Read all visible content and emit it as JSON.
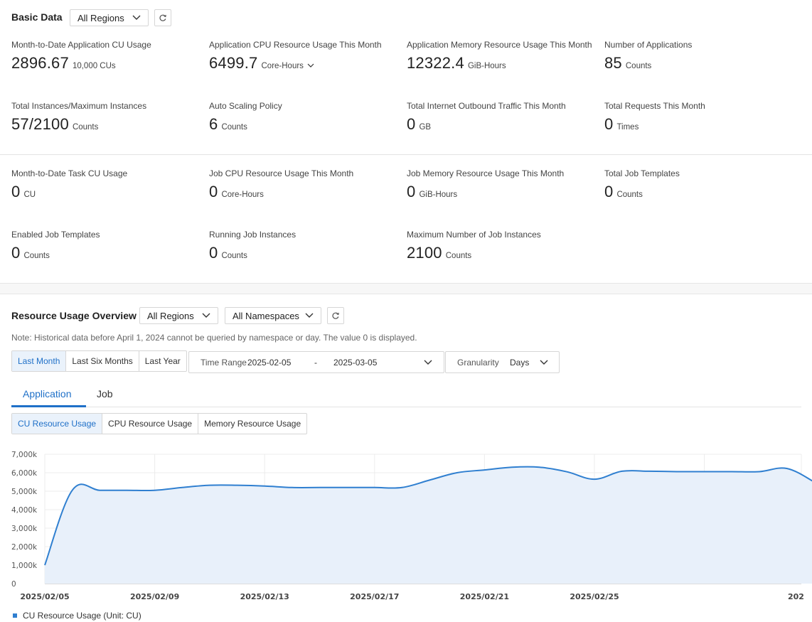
{
  "basic": {
    "title": "Basic Data",
    "region_select": "All Regions",
    "metrics_app": [
      {
        "label": "Month-to-Date Application CU Usage",
        "value": "2896.67",
        "unit": "10,000 CUs"
      },
      {
        "label": "Application CPU Resource Usage This Month",
        "value": "6499.7",
        "unit": "Core-Hours"
      },
      {
        "label": "Application Memory Resource Usage This Month",
        "value": "12322.4",
        "unit": "GiB-Hours"
      },
      {
        "label": "Number of Applications",
        "value": "85",
        "unit": "Counts"
      },
      {
        "label": "Total Instances/Maximum Instances",
        "value": "57/2100",
        "unit": "Counts"
      },
      {
        "label": "Auto Scaling Policy",
        "value": "6",
        "unit": "Counts"
      },
      {
        "label": "Total Internet Outbound Traffic This Month",
        "value": "0",
        "unit": "GB"
      },
      {
        "label": "Total Requests This Month",
        "value": "0",
        "unit": "Times"
      }
    ],
    "metrics_job": [
      {
        "label": "Month-to-Date Task CU Usage",
        "value": "0",
        "unit": "CU"
      },
      {
        "label": "Job CPU Resource Usage This Month",
        "value": "0",
        "unit": "Core-Hours"
      },
      {
        "label": "Job Memory Resource Usage This Month",
        "value": "0",
        "unit": "GiB-Hours"
      },
      {
        "label": "Total Job Templates",
        "value": "0",
        "unit": "Counts"
      },
      {
        "label": "Enabled Job Templates",
        "value": "0",
        "unit": "Counts"
      },
      {
        "label": "Running Job Instances",
        "value": "0",
        "unit": "Counts"
      },
      {
        "label": "Maximum Number of Job Instances",
        "value": "2100",
        "unit": "Counts"
      }
    ]
  },
  "overview": {
    "title": "Resource Usage Overview",
    "region_select": "All Regions",
    "namespace_select": "All Namespaces",
    "note": "Note: Historical data before April 1, 2024 cannot be queried by namespace or day. The value 0 is displayed.",
    "range_buttons": [
      "Last Month",
      "Last Six Months",
      "Last Year"
    ],
    "active_range": "Last Month",
    "time_range_label": "Time Range",
    "start_date": "2025-02-05",
    "date_separator": "-",
    "end_date": "2025-03-05",
    "granularity_label": "Granularity",
    "granularity_value": "Days",
    "tabs": [
      "Application",
      "Job"
    ],
    "active_tab": "Application",
    "metric_buttons": [
      "CU Resource Usage",
      "CPU Resource Usage",
      "Memory Resource Usage"
    ],
    "active_metric": "CU Resource Usage"
  },
  "colors": {
    "accent": "#1f70c8",
    "line": "#2f7fd0",
    "area": "#e8f0fa"
  },
  "chart_data": {
    "type": "area",
    "x": [
      "2025/02/05",
      "2025/02/06",
      "2025/02/07",
      "2025/02/08",
      "2025/02/09",
      "2025/02/10",
      "2025/02/11",
      "2025/02/12",
      "2025/02/13",
      "2025/02/14",
      "2025/02/15",
      "2025/02/16",
      "2025/02/17",
      "2025/02/18",
      "2025/02/19",
      "2025/02/20",
      "2025/02/21",
      "2025/02/22",
      "2025/02/23",
      "2025/02/24",
      "2025/02/25",
      "2025/02/26",
      "2025/02/27",
      "2025/02/28",
      "2025/03/01",
      "2025/03/02",
      "2025/03/03",
      "2025/03/04",
      "2025/03/05"
    ],
    "series": [
      {
        "name": "CU Resource Usage (Unit: CU)",
        "values": [
          1000,
          5050,
          5050,
          5050,
          5050,
          5200,
          5320,
          5320,
          5280,
          5200,
          5200,
          5200,
          5200,
          5200,
          5600,
          6000,
          6150,
          6300,
          6300,
          6050,
          5650,
          6080,
          6080,
          6060,
          6060,
          6060,
          6060,
          6230,
          5500
        ]
      }
    ],
    "x_tick_labels": [
      "2025/02/05",
      "2025/02/09",
      "2025/02/13",
      "2025/02/17",
      "2025/02/21",
      "2025/02/25",
      "202"
    ],
    "y_tick_labels": [
      "0",
      "1,000k",
      "2,000k",
      "3,000k",
      "4,000k",
      "5,000k",
      "6,000k",
      "7,000k"
    ],
    "ylim": [
      0,
      7000
    ],
    "y_unit_note": "k",
    "legend": "bottom-left",
    "grid": true
  }
}
